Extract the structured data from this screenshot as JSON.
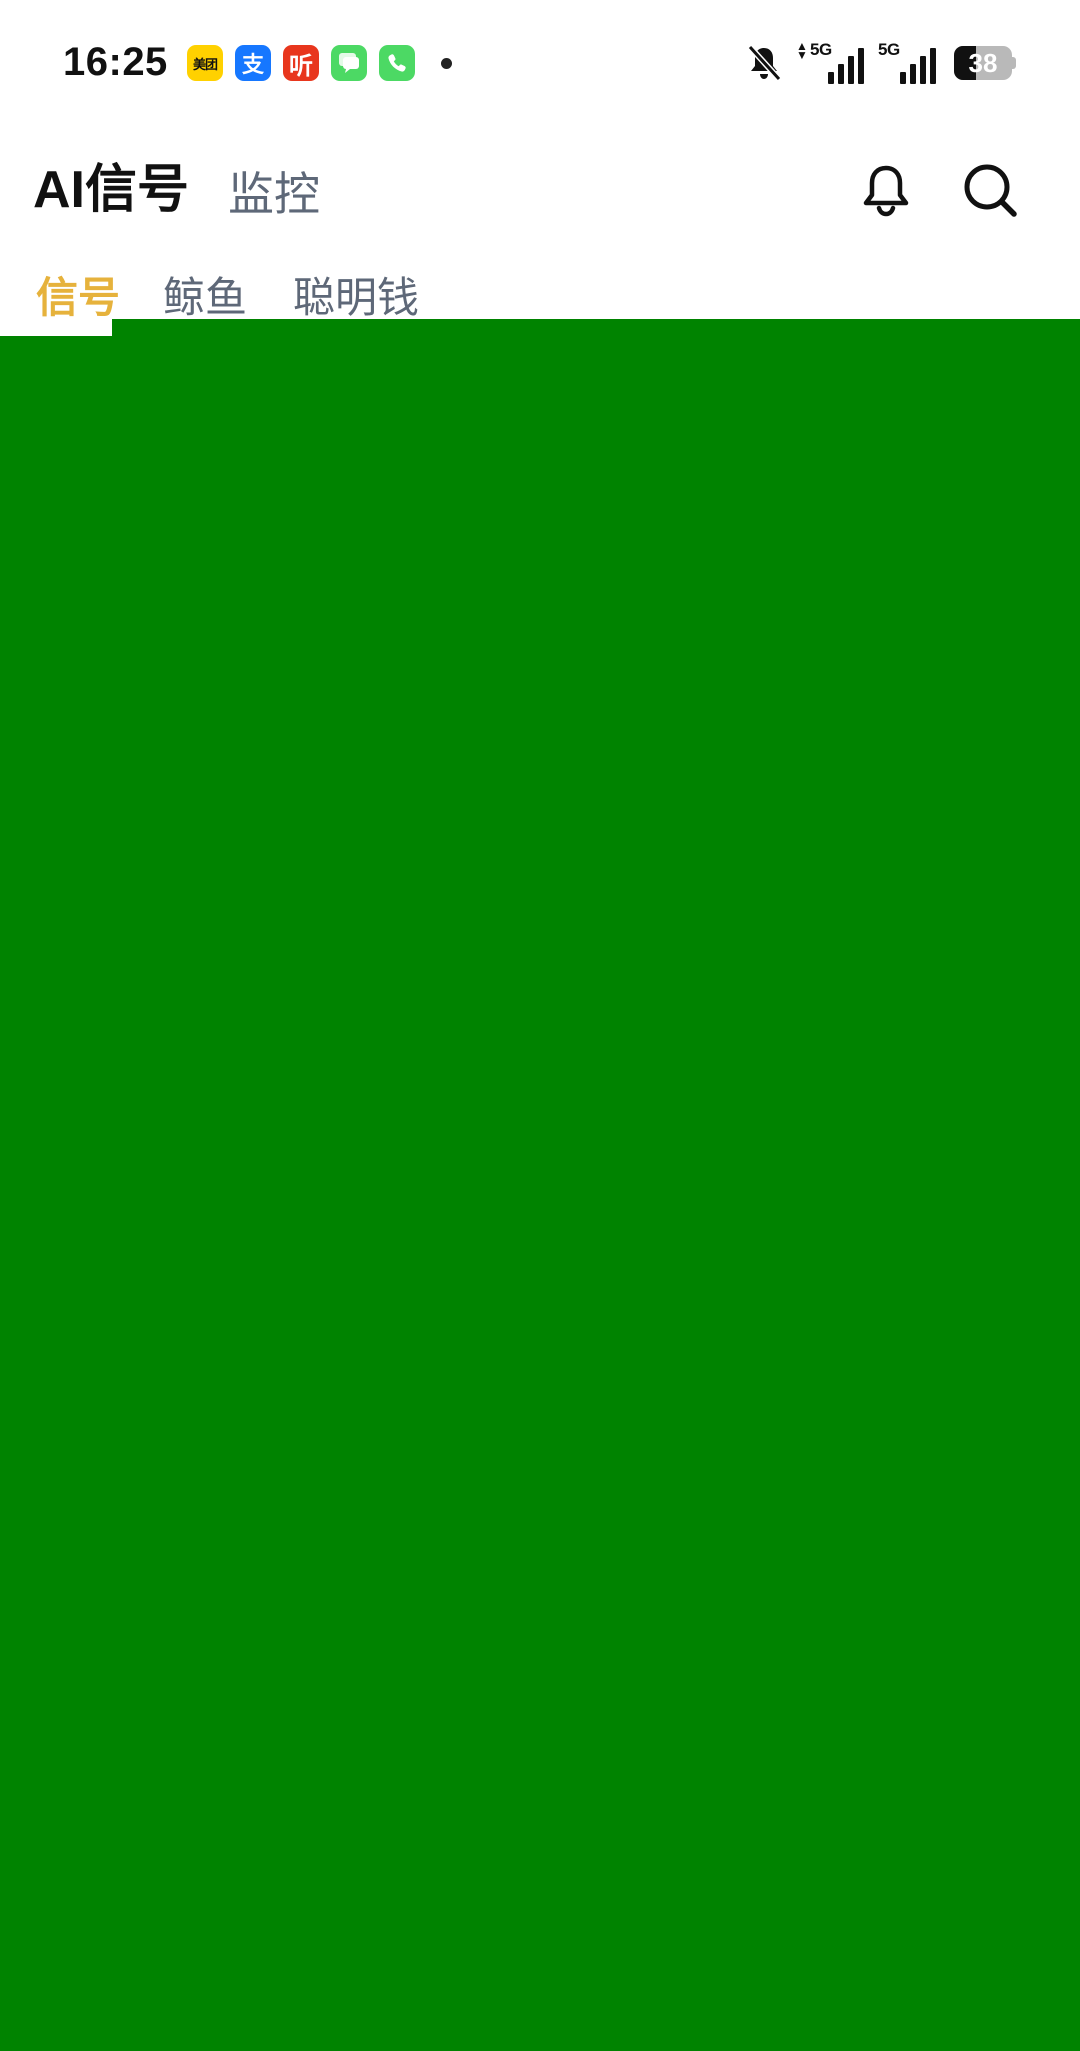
{
  "status_bar": {
    "time": "16:25",
    "notification_apps": [
      {
        "name": "meituan-icon",
        "glyph": "美团",
        "color": "#FFD100"
      },
      {
        "name": "alipay-icon",
        "glyph": "支",
        "color": "#1677FF"
      },
      {
        "name": "ting-icon",
        "glyph": "听",
        "color": "#E8361D"
      },
      {
        "name": "messages-icon",
        "glyph": "",
        "color": "#4CD964"
      },
      {
        "name": "phone-icon",
        "glyph": "",
        "color": "#4CD964"
      }
    ],
    "signal_1_label": "5G",
    "signal_2_label": "5G",
    "battery_level": "38",
    "battery_fraction": 0.38
  },
  "header": {
    "title": "AI信号",
    "monitor_tab": "监控"
  },
  "sub_tabs": [
    {
      "label": "信号",
      "active": true
    },
    {
      "label": "鲸鱼",
      "active": false
    },
    {
      "label": "聪明钱",
      "active": false
    }
  ],
  "colors": {
    "accent": "#E6B23C",
    "content_background": "#008300",
    "inactive_text": "#5e6878"
  }
}
